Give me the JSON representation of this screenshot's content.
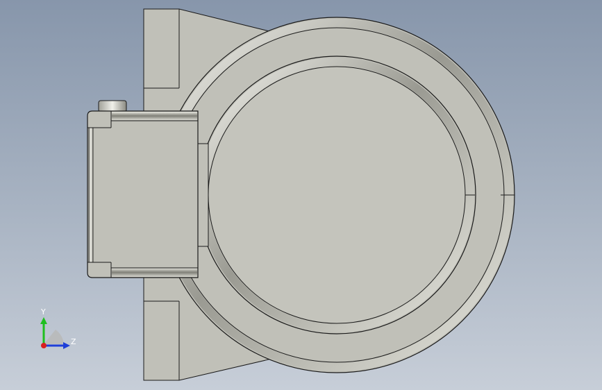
{
  "viewport": {
    "background_top": "#8796ab",
    "background_bottom": "#c7ced8"
  },
  "model": {
    "body_color": "#c0c0b8",
    "edge_color": "#1a1a1a"
  },
  "triad": {
    "y_label": "Y",
    "z_label": "Z",
    "y_color": "#1fbf1f",
    "z_color": "#1f3fd8",
    "x_color": "#d81f1f",
    "icons": [
      "axis-y-arrow-icon",
      "axis-z-arrow-icon",
      "axis-origin-icon"
    ]
  }
}
